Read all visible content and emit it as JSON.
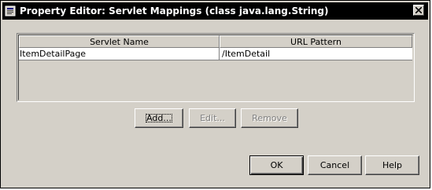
{
  "window": {
    "title": "Property Editor: Servlet Mappings (class java.lang.String)",
    "icon": "app-window-icon",
    "close_icon": "close-icon"
  },
  "table": {
    "columns": [
      "Servlet Name",
      "URL Pattern"
    ],
    "rows": [
      {
        "servlet_name": "ItemDetailPage",
        "url_pattern": "/ItemDetail"
      }
    ]
  },
  "buttons": {
    "add": "Add...",
    "edit": "Edit...",
    "remove": "Remove",
    "ok": "OK",
    "cancel": "Cancel",
    "help": "Help"
  }
}
